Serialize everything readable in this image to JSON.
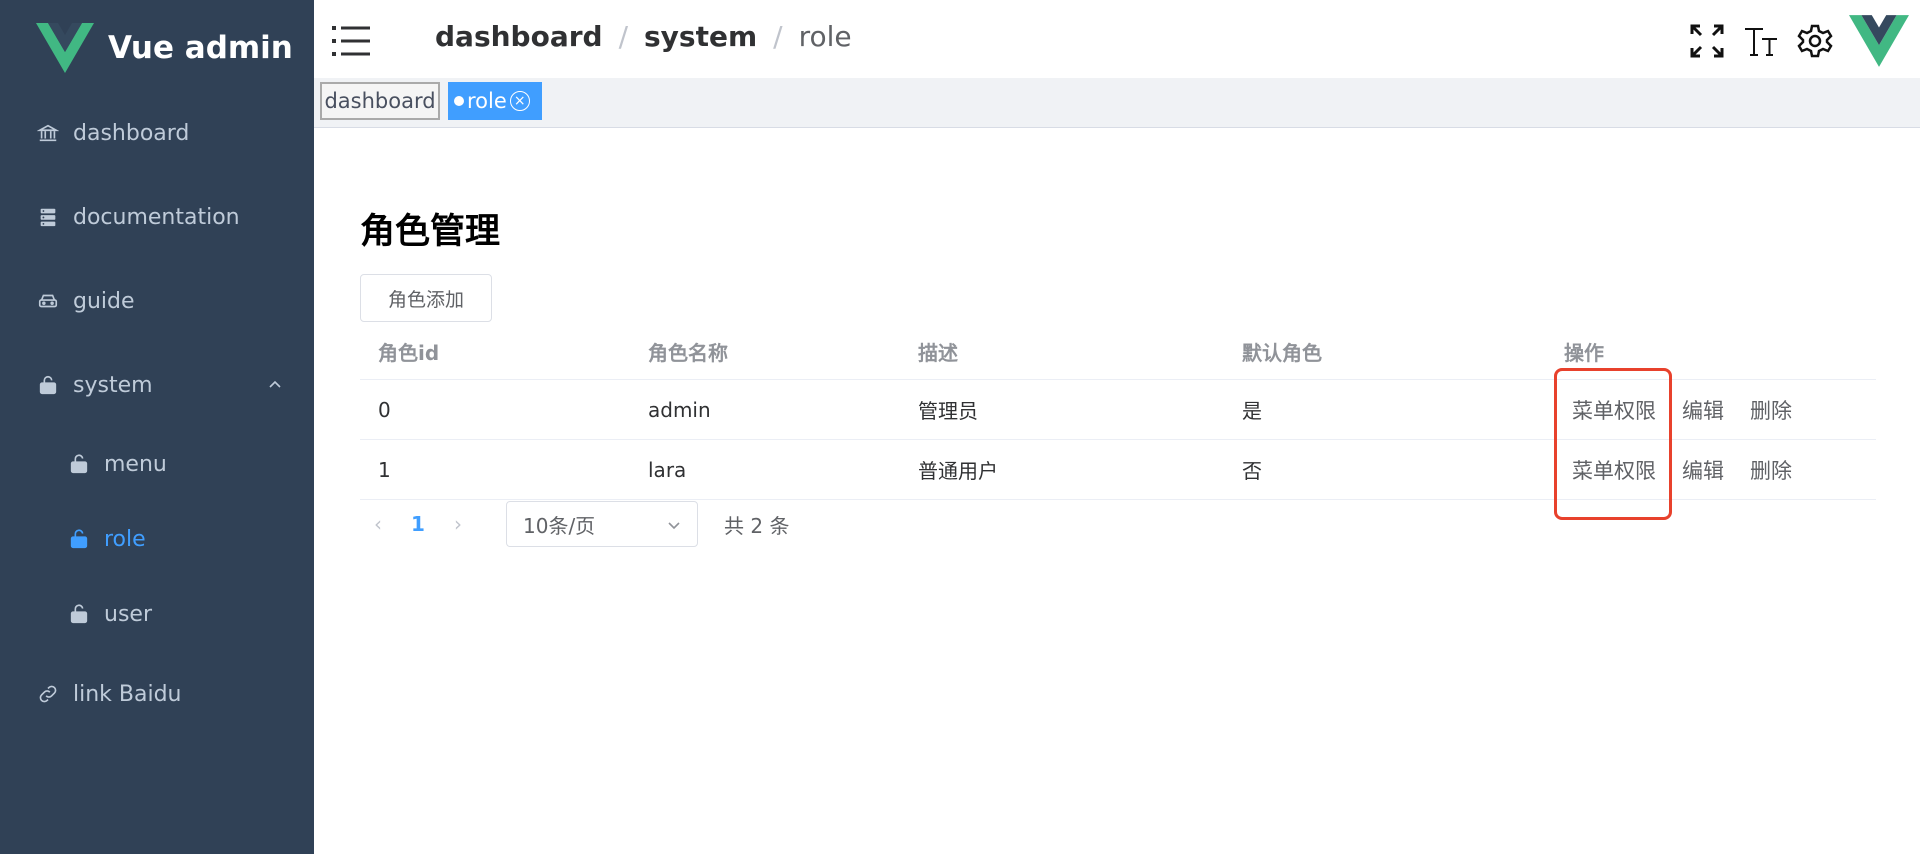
{
  "app": {
    "brand": "Vue admin"
  },
  "sidebar": {
    "items": [
      {
        "label": "dashboard",
        "icon": "bank-icon"
      },
      {
        "label": "documentation",
        "icon": "server-icon"
      },
      {
        "label": "guide",
        "icon": "car-icon"
      },
      {
        "label": "system",
        "icon": "lock-icon"
      },
      {
        "label": "menu",
        "icon": "unlock-icon"
      },
      {
        "label": "role",
        "icon": "unlock-icon"
      },
      {
        "label": "user",
        "icon": "unlock-icon"
      },
      {
        "label": "link Baidu",
        "icon": "link-icon"
      }
    ]
  },
  "header": {
    "breadcrumb": [
      "dashboard",
      "system",
      "role"
    ],
    "separator": "/",
    "icons": [
      "fullscreen-icon",
      "font-size-icon",
      "settings-icon",
      "vue-logo-icon"
    ]
  },
  "tags": {
    "dashboard": "dashboard",
    "role": "role",
    "close_glyph": "×"
  },
  "main": {
    "title": "角色管理",
    "add_button": "角色添加",
    "columns": [
      "角色id",
      "角色名称",
      "描述",
      "默认角色",
      "操作"
    ],
    "rows": [
      {
        "id": "0",
        "name": "admin",
        "desc": "管理员",
        "default": "是"
      },
      {
        "id": "1",
        "name": "lara",
        "desc": "普通用户",
        "default": "否"
      }
    ],
    "actions": {
      "perm": "菜单权限",
      "edit": "编辑",
      "delete": "删除"
    },
    "pager": {
      "prev": "‹",
      "page": "1",
      "next": "›",
      "page_size": "10条/页",
      "total": "共 2 条"
    }
  },
  "colors": {
    "sidebar_bg": "#304156",
    "accent": "#409eff",
    "highlight": "#e8412c"
  }
}
